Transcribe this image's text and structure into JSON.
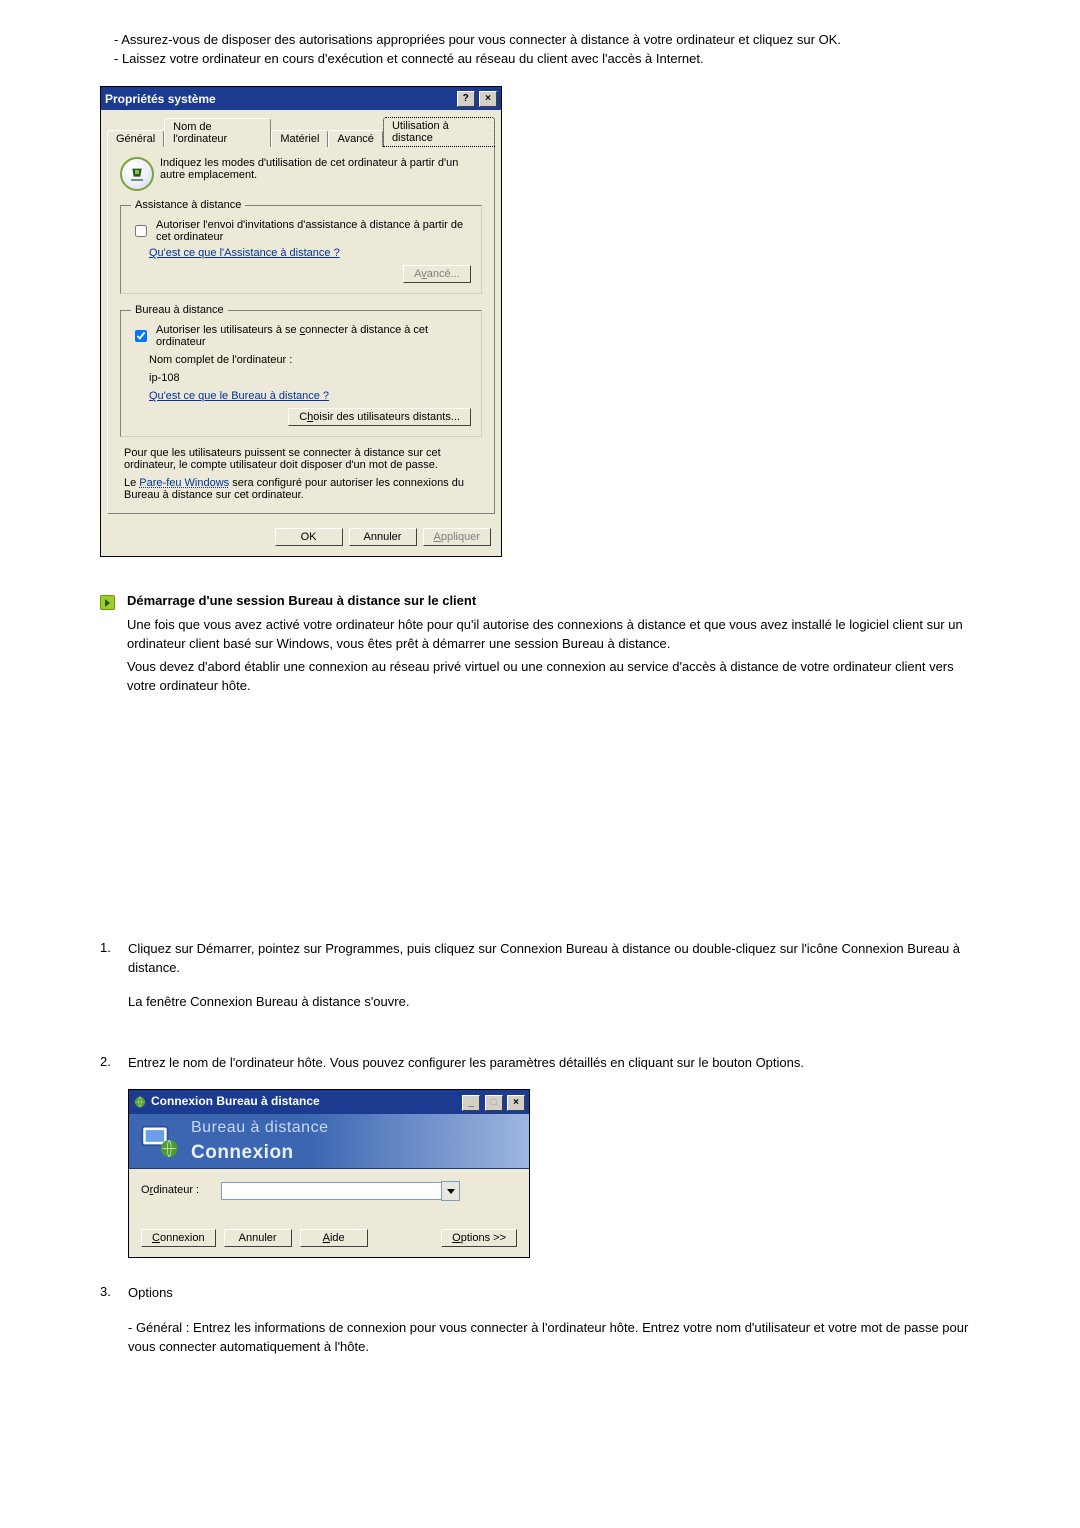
{
  "intro": {
    "bullet1": "Assurez-vous de disposer des autorisations appropriées pour vous connecter à distance à votre ordinateur et cliquez sur OK.",
    "bullet2": "Laissez votre ordinateur en cours d'exécution et connecté au réseau du client avec l'accès à Internet."
  },
  "dialog1": {
    "title": "Propriétés système",
    "help_btn": "?",
    "close_btn": "×",
    "tabs": {
      "general": "Général",
      "computer_name": "Nom de l'ordinateur",
      "hardware": "Matériel",
      "advanced": "Avancé",
      "remote": "Utilisation à distance"
    },
    "intro_text": "Indiquez les modes d'utilisation de cet ordinateur à partir d'un autre emplacement.",
    "assist": {
      "legend": "Assistance à distance",
      "checkbox": "Autoriser l'envoi d'invitations d'assistance à distance à partir de cet ordinateur",
      "link": "Qu'est ce que l'Assistance à distance ?",
      "adv_pre": "A",
      "adv_accel": "v",
      "adv_post": "ancé..."
    },
    "remote": {
      "legend": "Bureau à distance",
      "cb_pre": "Autoriser les utilisateurs à se ",
      "cb_accel": "c",
      "cb_post": "onnecter à distance à cet ordinateur",
      "fullname_label": "Nom complet de l'ordinateur :",
      "fullname_value": "ip-108",
      "link": "Qu'est ce que le Bureau à distance ?",
      "sel_pre": "C",
      "sel_accel": "h",
      "sel_post": "oisir des utilisateurs distants..."
    },
    "notice": "Pour que les utilisateurs puissent se connecter à distance sur cet ordinateur, le compte utilisateur doit disposer d'un mot de passe.",
    "firewall_pre": "Le ",
    "firewall_link": "Pare-feu Windows",
    "firewall_post": " sera configuré pour autoriser les connexions du Bureau à distance sur cet ordinateur.",
    "ok": "OK",
    "cancel": "Annuler",
    "apply_accel": "A",
    "apply_post": "ppliquer"
  },
  "section": {
    "title": "Démarrage d'une session Bureau à distance sur le client",
    "p1": "Une fois que vous avez activé votre ordinateur hôte pour qu'il autorise des connexions à distance et que vous avez installé le logiciel client sur un ordinateur client basé sur Windows, vous êtes prêt à démarrer une session Bureau à distance.",
    "p2": "Vous devez d'abord établir une connexion au réseau privé virtuel ou une connexion au service d'accès à distance de votre ordinateur client vers votre ordinateur hôte."
  },
  "steps": {
    "s1a": "Cliquez sur Démarrer, pointez sur Programmes, puis cliquez sur Connexion Bureau à distance ou double-cliquez sur l'icône Connexion Bureau à distance.",
    "s1b": "La fenêtre Connexion Bureau à distance s'ouvre.",
    "s2": "Entrez le nom de l'ordinateur hôte. Vous pouvez configurer les paramètres détaillés en cliquant sur le bouton Options.",
    "s3a": "Options",
    "s3b": "- Général : Entrez les informations de connexion pour vous connecter à l'ordinateur hôte. Entrez votre nom d'utilisateur et votre mot de passe pour vous connecter automatiquement à l'hôte."
  },
  "dialog2": {
    "title": "Connexion Bureau à distance",
    "min_btn": "_",
    "max_btn": "□",
    "close_btn": "×",
    "banner_l1": "Bureau à distance",
    "banner_l2": "Connexion",
    "computer_pre": "O",
    "computer_accel": "r",
    "computer_post": "dinateur :",
    "computer_value": "",
    "connect_accel": "C",
    "connect_post": "onnexion",
    "cancel": "Annuler",
    "help_accel": "A",
    "help_post": "ide",
    "options_accel": "O",
    "options_post": "ptions >>"
  }
}
